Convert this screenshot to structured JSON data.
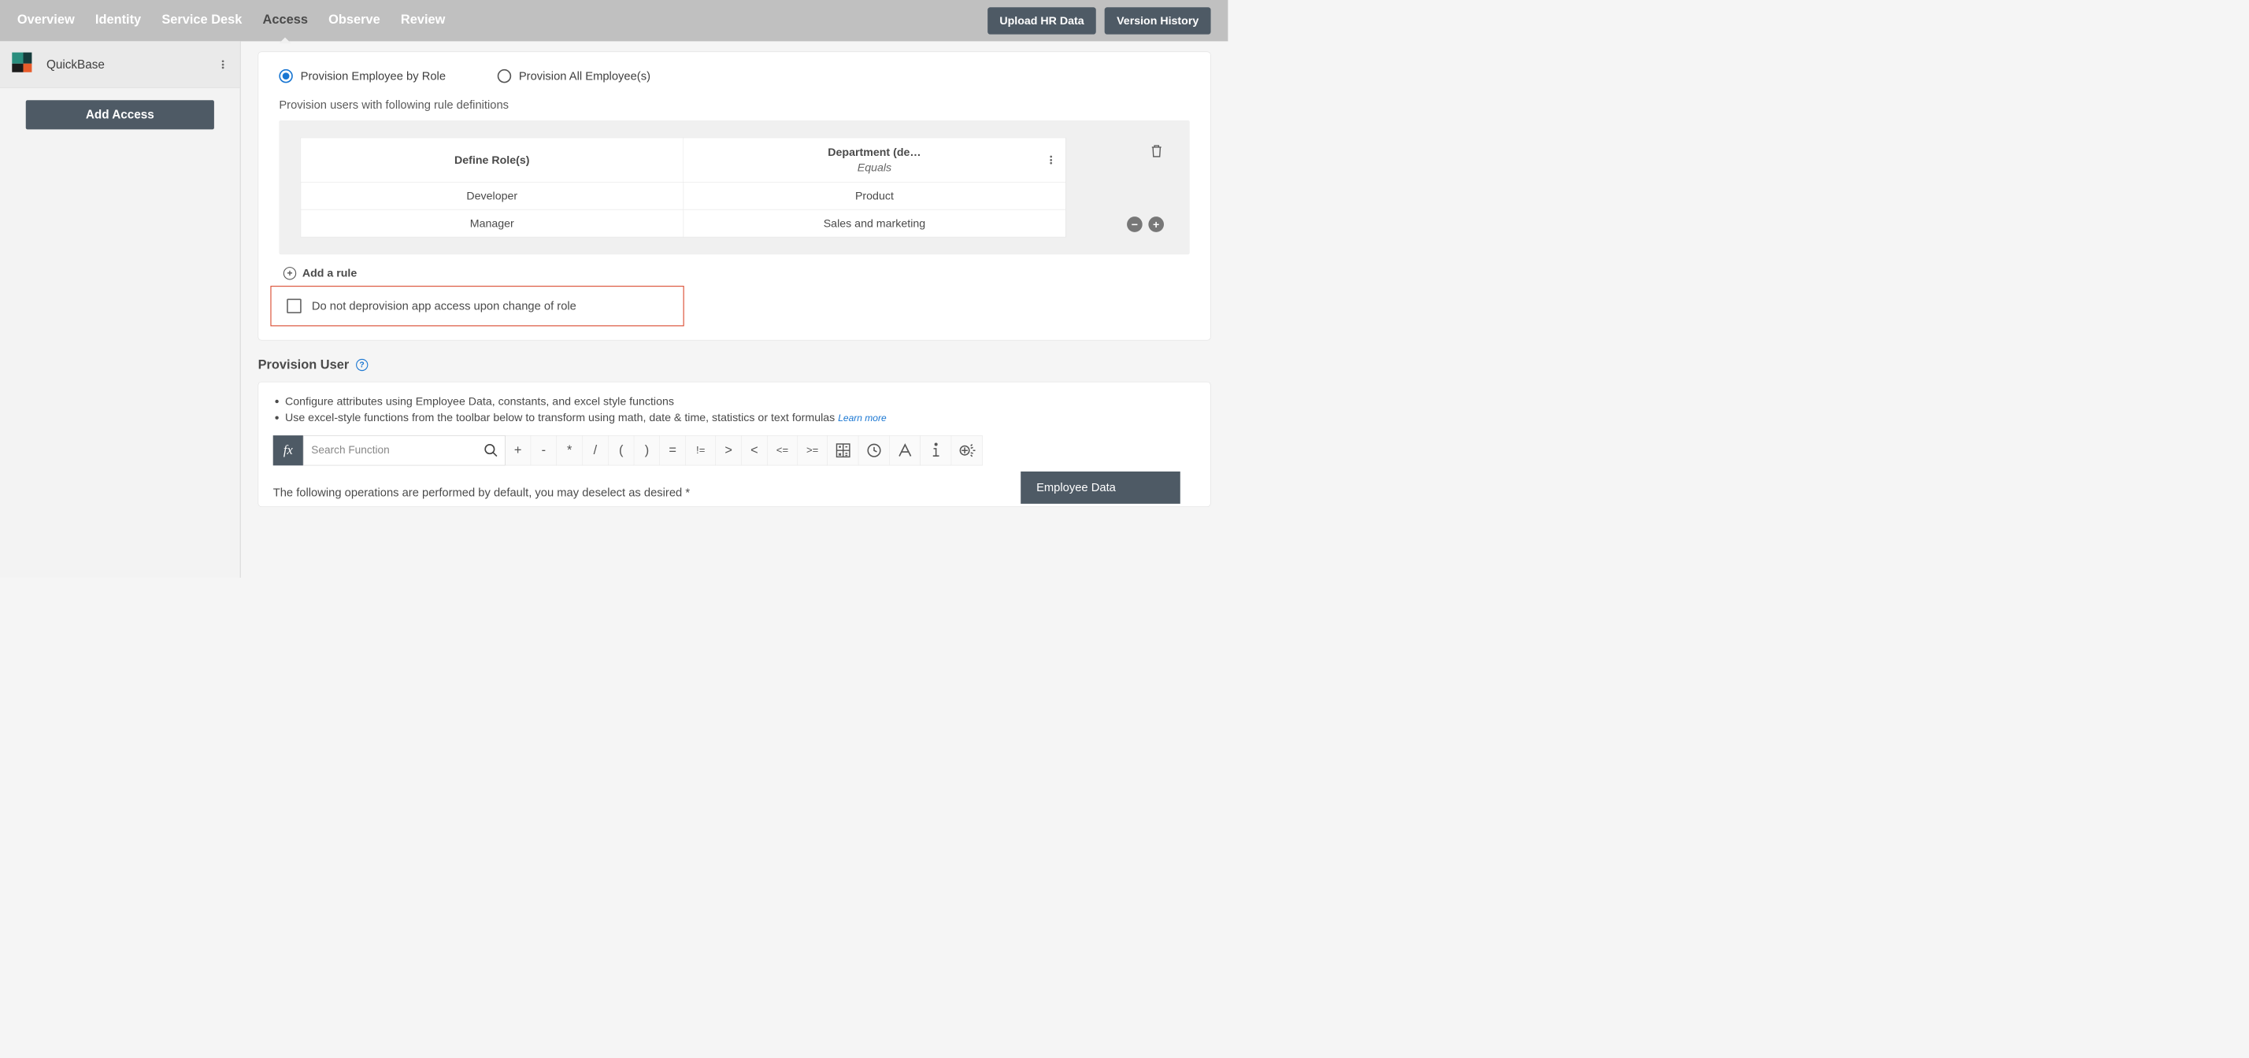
{
  "nav": {
    "items": [
      "Overview",
      "Identity",
      "Service Desk",
      "Access",
      "Observe",
      "Review"
    ],
    "active_index": 3
  },
  "top_buttons": {
    "upload": "Upload HR Data",
    "history": "Version History"
  },
  "sidebar": {
    "app_name": "QuickBase",
    "add_access": "Add Access"
  },
  "provision": {
    "radio_by_role": "Provision Employee by Role",
    "radio_all": "Provision All Employee(s)",
    "selected": "by_role",
    "subhead": "Provision users with following rule definitions",
    "table": {
      "col1_header": "Define Role(s)",
      "col2_header_top": "Department (de…",
      "col2_header_sub": "Equals",
      "rows": [
        {
          "role": "Developer",
          "dept": "Product"
        },
        {
          "role": "Manager",
          "dept": "Sales and marketing"
        }
      ]
    },
    "add_rule": "Add a rule",
    "no_deprovision": "Do not deprovision app access upon change of role"
  },
  "provision_user": {
    "title": "Provision User",
    "bullet1": "Configure attributes using Employee Data, constants, and excel style functions",
    "bullet2": "Use excel-style functions from the toolbar below to transform using math, date & time, statistics or text formulas",
    "learn_more": "Learn more",
    "search_placeholder": "Search Function",
    "operators": [
      "+",
      "-",
      "*",
      "/",
      "(",
      ")",
      "=",
      "!=",
      ">",
      "<",
      "<=",
      ">="
    ],
    "default_note": "The following operations are performed by default, you may deselect as desired *",
    "employee_data_btn": "Employee Data"
  }
}
